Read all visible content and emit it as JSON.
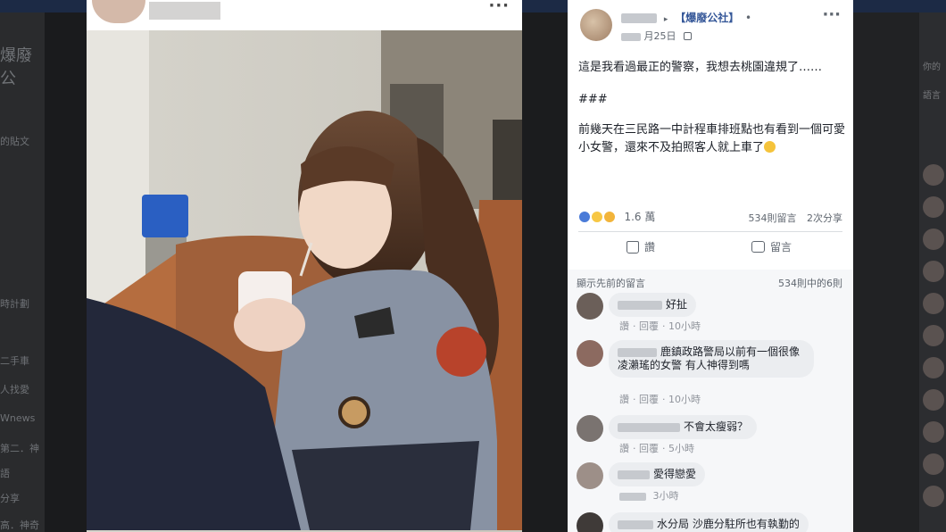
{
  "background": {
    "left_title": "爆廢公",
    "left_items": [
      "的貼文",
      "時計劃",
      "二手車",
      "人找愛",
      "Wnews",
      "第二．神",
      "語",
      "分享",
      "高．神奇"
    ],
    "right_items": [
      "你的",
      "語言"
    ]
  },
  "photo_panel": {
    "more_label": "···"
  },
  "post": {
    "group_name": "【爆廢公社】",
    "author_separator": "▸",
    "group_dot": "•",
    "date": "月25日",
    "more_label": "···",
    "body_line1": "這是我看過最正的警察，我想去桃園違規了……",
    "separator": "###",
    "body_line2": "前幾天在三民路一中計程車排班點也有看到一個可愛小女警，還來不及拍照客人就上車了",
    "reaction_count": "1.6 萬",
    "comment_count": "534則留言",
    "share_count": "2次分享",
    "like_label": "讚",
    "comment_label": "留言"
  },
  "comments_section": {
    "header": "顯示先前的留言",
    "count": "534則中的6則",
    "items": [
      {
        "text": "好扯",
        "like": "讚",
        "reply": "回覆",
        "time": "10小時"
      },
      {
        "text": "鹿鎮政路警局以前有一個很像凌瀨瑤的女警 有人神得到嗎",
        "like": "讚",
        "reply": "回覆",
        "time": "10小時"
      },
      {
        "text": "不會太瘦弱？",
        "like": "讚",
        "reply": "回覆",
        "time": "5小時"
      },
      {
        "text": "愛得戀愛",
        "like": "",
        "reply": "",
        "time": "3小時"
      },
      {
        "text": "水分局 沙鹿分駐所也有執勤的",
        "like": "",
        "reply": "",
        "time": ""
      }
    ]
  }
}
